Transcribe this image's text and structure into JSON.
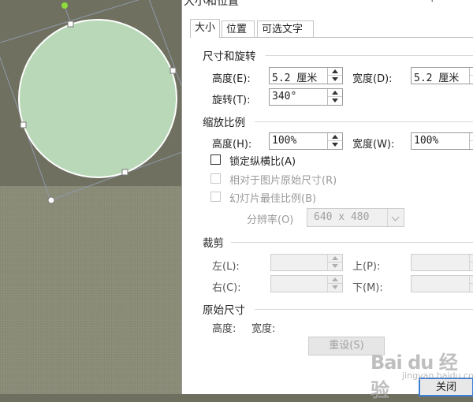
{
  "dialog": {
    "title": "大小和位置",
    "help": "?",
    "tabs": [
      {
        "label": "大小"
      },
      {
        "label": "位置"
      },
      {
        "label": "可选文字"
      }
    ]
  },
  "size_rotate": {
    "header": "尺寸和旋转",
    "height_label": "高度(E):",
    "height_value": "5.2 厘米",
    "width_label": "宽度(D):",
    "width_value": "5.2 厘米",
    "rotate_label": "旋转(T):",
    "rotate_value": "340°"
  },
  "scale": {
    "header": "缩放比例",
    "height_label": "高度(H):",
    "height_value": "100%",
    "width_label": "宽度(W):",
    "width_value": "100%",
    "lock_ratio_label": "锁定纵横比(A)",
    "relative_original_label": "相对于图片原始尺寸(R)",
    "best_slide_label": "幻灯片最佳比例(B)",
    "resolution_label": "分辨率(O)",
    "resolution_value": "640 x 480"
  },
  "crop": {
    "header": "裁剪",
    "left_label": "左(L):",
    "top_label": "上(P):",
    "right_label": "右(C):",
    "bottom_label": "下(M):"
  },
  "original_size": {
    "header": "原始尺寸",
    "height_label": "高度:",
    "width_label": "宽度:",
    "reset_label": "重设(S)"
  },
  "footer": {
    "close_label": "关闭"
  },
  "watermark": {
    "text": "Bai du 经验",
    "sub": "jingyan.baidu.com"
  },
  "colors": {
    "circle_fill": "#b8d8b8",
    "canvas_top": "#707060",
    "canvas_bottom": "#8a8c78",
    "rotate_handle": "#8fdc3c"
  }
}
